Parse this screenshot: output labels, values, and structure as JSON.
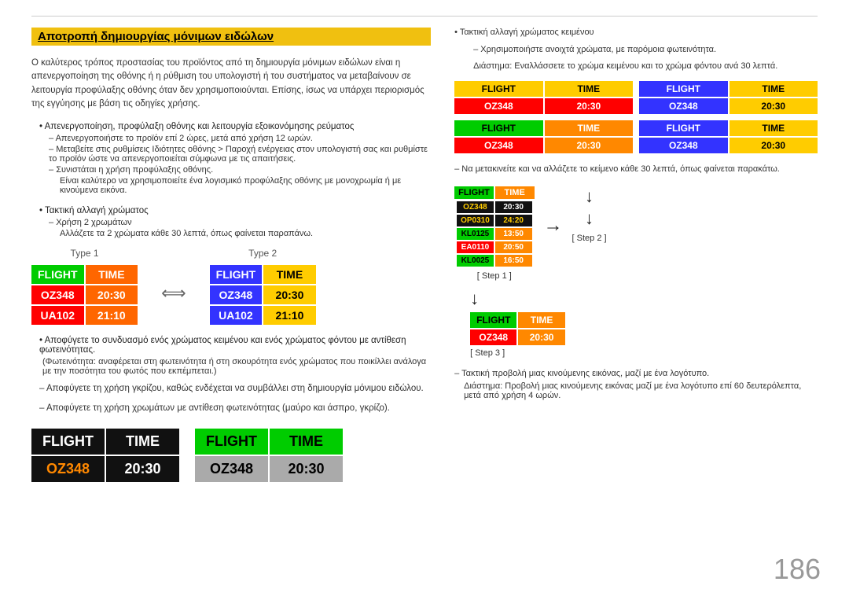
{
  "page": {
    "number": "186"
  },
  "header": {
    "title": "Αποτροπή δημιουργίας μόνιμων ειδώλων"
  },
  "left": {
    "intro": "Ο καλύτερος τρόπος προστασίας του προϊόντος από τη δημιουργία μόνιμων ειδώλων είναι η απενεργοποίηση της οθόνης ή η ρύθμιση του υπολογιστή ή του συστήματος να μεταβαίνουν σε λειτουργία προφύλαξης οθόνης όταν δεν χρησιμοποιούνται. Επίσης, ίσως να υπάρχει περιορισμός της εγγύησης με βάση τις οδηγίες χρήσης.",
    "bullet1": "Απενεργοποίηση, προφύλαξη οθόνης και λειτουργία εξοικονόμησης ρεύματος",
    "bullet1_sub1": "Απενεργοποιήστε το προϊόν επί 2 ώρες, μετά από χρήση 12 ωρών.",
    "bullet1_sub2": "Μεταβείτε στις ρυθμίσεις Ιδιότητες οθόνης > Παροχή ενέργειας στον υπολογιστή σας και ρυθμίστε το προϊόν ώστε να απενεργοποιείται σύμφωνα με τις απαιτήσεις.",
    "bullet1_sub3": "Συνιστάται η χρήση προφύλαξης οθόνης.",
    "bullet1_sub3b": "Είναι καλύτερο να χρησιμοποιείτε ένα λογισμικό προφύλαξης οθόνης με μονοχρωμία ή με κινούμενα εικόνα.",
    "bullet2": "Τακτική αλλαγή χρώματος",
    "bullet2_sub1": "Χρήση 2 χρωμάτων",
    "bullet2_sub1b": "Αλλάζετε τα 2 χρώματα κάθε 30 λεπτά, όπως φαίνεται παραπάνω.",
    "type1_label": "Type 1",
    "type2_label": "Type 2",
    "widget": {
      "flight": "FLIGHT",
      "colon": ":",
      "time": "TIME",
      "oz348": "OZ348",
      "t2030": "20:30",
      "ua102": "UA102",
      "t2110": "21:10"
    },
    "bullet3": "Αποφύγετε το συνδυασμό ενός χρώματος κειμένου και ενός χρώματος φόντου με αντίθεση φωτεινότητας.",
    "bullet3b": "(Φωτεινότητα: αναφέρεται στη φωτεινότητα ή στη σκουρότητα ενός χρώματος που ποικίλλει ανάλογα με την ποσότητα του φωτός που εκπέμπεται.)",
    "note1": "– Αποφύγετε τη χρήση γκρίζου, καθώς ενδέχεται να συμβάλλει στη δημιουργία μόνιμου ειδώλου.",
    "note2": "– Αποφύγετε τη χρήση χρωμάτων με αντίθεση φωτεινότητας (μαύρο και άσπρο, γκρίζο).",
    "bottom": {
      "b1": {
        "flight": "FLIGHT",
        "colon": ":",
        "time": "TIME",
        "oz": "OZ348",
        "colon2": ":",
        "t": "20:30"
      },
      "b2": {
        "flight": "FLIGHT",
        "colon": ":",
        "time": "TIME",
        "oz": "OZ348",
        "colon2": ":",
        "t": "20:30"
      }
    }
  },
  "right": {
    "note_bullet": "Τακτική αλλαγή χρώματος κειμένου",
    "note_sub1": "– Χρησιμοποιήστε ανοιχτά χρώματα, με παρόμοια φωτεινότητα.",
    "note_sub2": "Διάστημα: Εναλλάσσετε το χρώμα κειμένου και το χρώμα φόντου ανά 30 λεπτά.",
    "grid": {
      "r1c1": {
        "flight": "FLIGHT",
        "colon": ":",
        "time": "TIME",
        "oz": "OZ348",
        "colon2": ":",
        "t": "20:30"
      },
      "r1c2": {
        "flight": "FLIGHT",
        "colon": ":",
        "time": "TIME",
        "oz": "OZ348",
        "colon2": ":",
        "t": "20:30"
      },
      "r2c1": {
        "flight": "FLIGHT",
        "colon": ":",
        "time": "TIME",
        "oz": "OZ348",
        "colon2": ":",
        "t": "20:30"
      },
      "r2c2": {
        "flight": "FLIGHT",
        "colon": ":",
        "time": "TIME",
        "oz": "OZ348",
        "colon2": ":",
        "t": "20:30"
      }
    },
    "scroll_note": "– Να μετακινείτε και να αλλάζετε το κείμενο κάθε 30 λεπτά, όπως φαίνεται παρακάτω.",
    "step1_label": "[ Step 1 ]",
    "step2_label": "[ Step 2 ]",
    "step3_label": "[ Step 3 ]",
    "step1": {
      "flight": "FLIGHT",
      "colon": ":",
      "time": "TIME",
      "oz": "OZ348",
      "colon2": ":",
      "t": "20:30",
      "rows": [
        {
          "l": "OP0310",
          "r": "24:20"
        },
        {
          "l": "KL0125",
          "r": "13:50"
        },
        {
          "l": "EA0110",
          "r": "20:50"
        },
        {
          "l": "KL0025",
          "r": "16:50"
        }
      ]
    },
    "step3": {
      "flight": "FLIGHT",
      "colon": ":",
      "time": "TIME",
      "oz": "OZ348",
      "colon2": ":",
      "t": "20:30"
    },
    "final_note1": "– Τακτική προβολή μιας κινούμενης εικόνας, μαζί με ένα λογότυπο.",
    "final_note2": "Διάστημα: Προβολή μιας κινούμενης εικόνας μαζί με ένα λογότυπο επί 60 δευτερόλεπτα, μετά από χρήση 4 ωρών."
  }
}
